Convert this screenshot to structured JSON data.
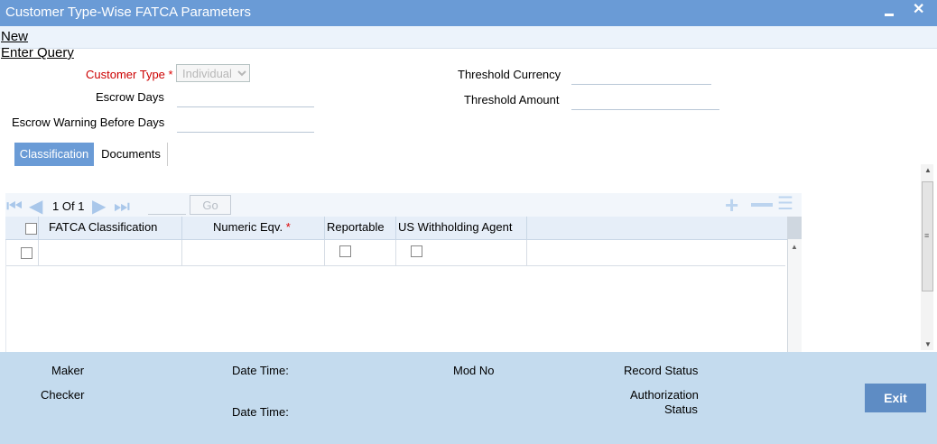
{
  "window": {
    "title": "Customer Type-Wise FATCA Parameters",
    "minimize_glyph": "▬",
    "close_glyph": "✕"
  },
  "toolbar": {
    "new_label": "New",
    "enter_query_label": "Enter Query"
  },
  "form": {
    "customer_type_label": "Customer Type",
    "required_mark": "*",
    "customer_type_value": "Individual",
    "escrow_days_label": "Escrow Days",
    "escrow_warning_label": "Escrow Warning Before Days",
    "threshold_currency_label": "Threshold Currency",
    "threshold_amount_label": "Threshold Amount"
  },
  "tabs": [
    {
      "label": "Classification",
      "active": true
    },
    {
      "label": "Documents",
      "active": false
    }
  ],
  "grid": {
    "page_current": "1",
    "page_of_label": "Of",
    "page_total": "1",
    "go_label": "Go",
    "columns": [
      "FATCA Classification",
      "Numeric Eqv.",
      "Reportable",
      "US Withholding Agent"
    ],
    "required_mark": "*"
  },
  "footer": {
    "maker_label": "Maker",
    "checker_label": "Checker",
    "date_time_label": "Date Time:",
    "mod_no_label": "Mod No",
    "record_status_label": "Record Status",
    "authorization_label": "Authorization",
    "status_label": "Status",
    "exit_label": "Exit"
  },
  "colors": {
    "title_bar": "#6a9bd6",
    "footer": "#c4dbee",
    "exit_button": "#5e8cc4",
    "required": "#cc0000"
  }
}
